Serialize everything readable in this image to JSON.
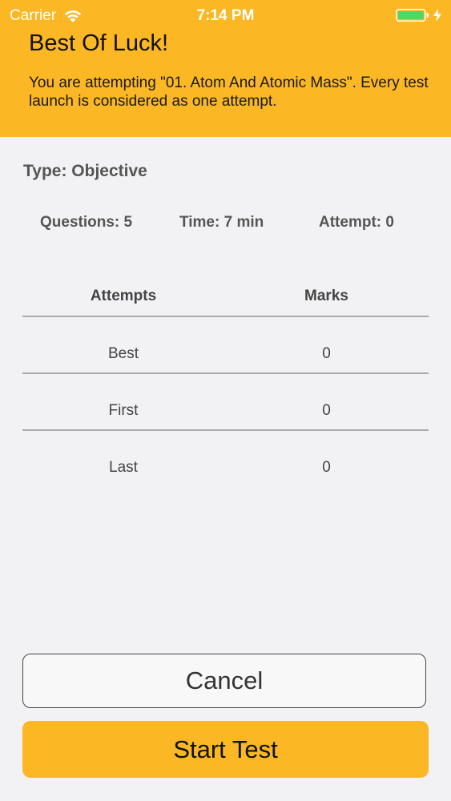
{
  "status_bar": {
    "carrier": "Carrier",
    "time": "7:14 PM"
  },
  "header": {
    "title": "Best Of Luck!",
    "subtitle": "You are attempting \"01. Atom And Atomic Mass\". Every test launch is considered as one attempt."
  },
  "test_info": {
    "type": "Type: Objective",
    "questions": "Questions: 5",
    "time": "Time: 7 min",
    "attempt": "Attempt: 0"
  },
  "table": {
    "headers": [
      "Attempts",
      "Marks"
    ],
    "rows": [
      [
        "Best",
        "0"
      ],
      [
        "First",
        "0"
      ],
      [
        "Last",
        "0"
      ]
    ]
  },
  "buttons": {
    "cancel": "Cancel",
    "start": "Start Test"
  },
  "colors": {
    "accent": "#fbb724",
    "background": "#f2f2f4",
    "battery": "#4cd964"
  },
  "icons": {
    "wifi": "wifi-icon",
    "battery": "battery-icon",
    "charging": "charging-bolt-icon"
  }
}
